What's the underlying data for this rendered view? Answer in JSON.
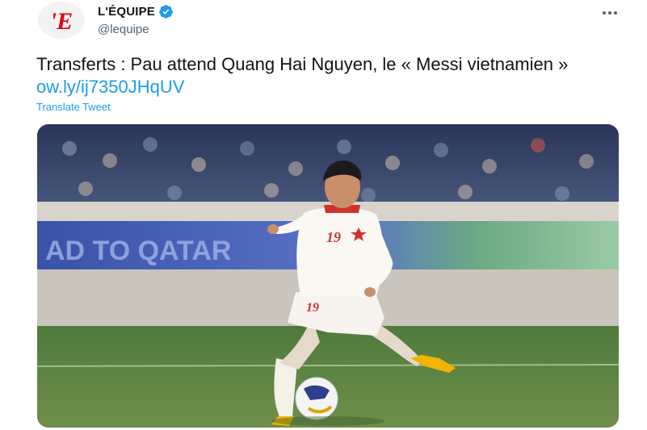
{
  "account": {
    "display_name": "L'ÉQUIPE",
    "handle": "@lequipe",
    "logo_text": "'E",
    "verified": true,
    "logo_color": "#e2001a"
  },
  "tweet": {
    "text_before_link": "Transferts : Pau attend Quang Hai Nguyen, le « Messi vietnamien » ",
    "link_text": "ow.ly/ij7350JHqUV",
    "translate_label": "Translate Tweet"
  },
  "media": {
    "banner_text": "AD TO QATAR",
    "jersey_number": "19"
  },
  "icons": {
    "more": "more-dots-icon",
    "verified": "verified-badge-icon"
  },
  "colors": {
    "link": "#1d9bf0",
    "text": "#0f1419",
    "secondary": "#536471",
    "verified": "#1d9bf0"
  }
}
